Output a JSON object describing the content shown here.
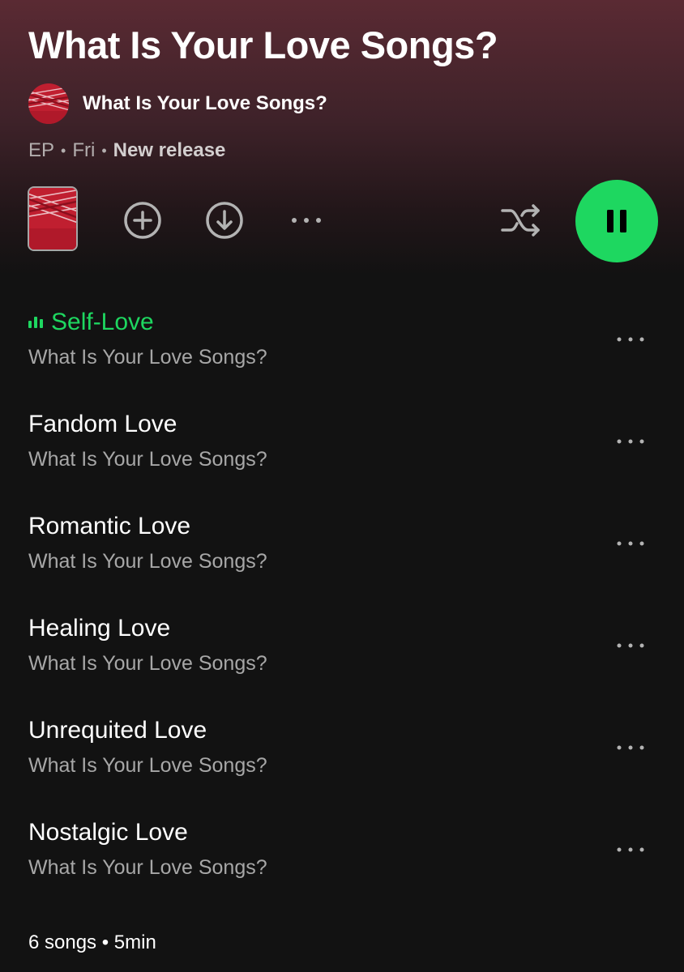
{
  "album": {
    "title": "What Is Your Love Songs?",
    "artist": "What Is Your Love Songs?",
    "cover_text": "WHAT IS YOUR LOVE SONGS?"
  },
  "meta": {
    "type": "EP",
    "separator": "•",
    "day": "Fri",
    "status": "New release"
  },
  "actions": {
    "add_icon": "plus-circle-icon",
    "download_icon": "download-circle-icon",
    "more_icon": "more-horizontal-icon",
    "shuffle_icon": "shuffle-icon",
    "play_state": "pause-icon"
  },
  "tracks": [
    {
      "title": "Self-Love",
      "artist": "What Is Your Love Songs?",
      "playing": true
    },
    {
      "title": "Fandom Love",
      "artist": "What Is Your Love Songs?",
      "playing": false
    },
    {
      "title": "Romantic Love",
      "artist": "What Is Your Love Songs?",
      "playing": false
    },
    {
      "title": "Healing Love",
      "artist": "What Is Your Love Songs?",
      "playing": false
    },
    {
      "title": "Unrequited Love",
      "artist": "What Is Your Love Songs?",
      "playing": false
    },
    {
      "title": "Nostalgic Love",
      "artist": "What Is Your Love Songs?",
      "playing": false
    }
  ],
  "summary": "6 songs • 5min",
  "colors": {
    "accent": "#1ed760",
    "background": "#121212",
    "header_gradient_top": "#5a2a33",
    "secondary_text": "#a7a7a7"
  }
}
